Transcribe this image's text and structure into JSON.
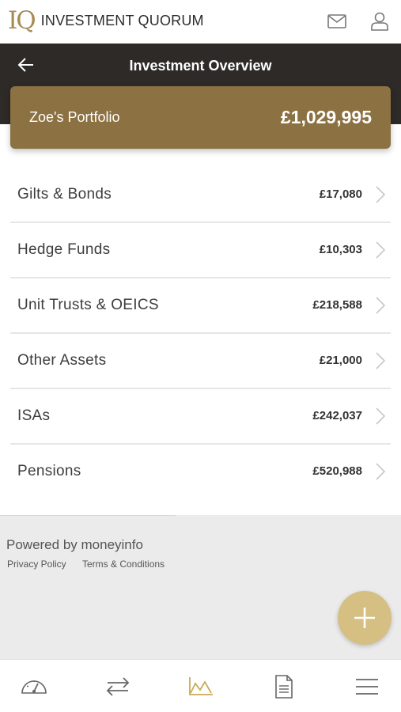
{
  "header": {
    "logo_mark": "IQ",
    "logo_text": "INVESTMENT QUORUM",
    "icons": [
      "mail-icon",
      "user-icon"
    ]
  },
  "titlebar": {
    "title": "Investment Overview",
    "back_icon": "arrow-left-icon"
  },
  "portfolio": {
    "name": "Zoe's Portfolio",
    "total": "£1,029,995"
  },
  "holdings": [
    {
      "label": "Gilts & Bonds",
      "value": "£17,080"
    },
    {
      "label": "Hedge Funds",
      "value": "£10,303"
    },
    {
      "label": "Unit Trusts & OEICS",
      "value": "£218,588"
    },
    {
      "label": "Other Assets",
      "value": "£21,000"
    },
    {
      "label": "ISAs",
      "value": "£242,037"
    },
    {
      "label": "Pensions",
      "value": "£520,988"
    }
  ],
  "footer": {
    "powered_by": "Powered by moneyinfo",
    "privacy": "Privacy Policy",
    "terms": "Terms & Conditions",
    "fab_icon": "plus-icon"
  },
  "bottom_nav": {
    "items": [
      "dashboard-gauge-icon",
      "transfer-arrows-icon",
      "chart-icon",
      "document-icon",
      "menu-icon"
    ],
    "active": "chart-icon"
  },
  "colors": {
    "accent_gold": "#8c7142",
    "fab_gold": "#d6bf83",
    "dark_bar": "#2e2a28"
  }
}
